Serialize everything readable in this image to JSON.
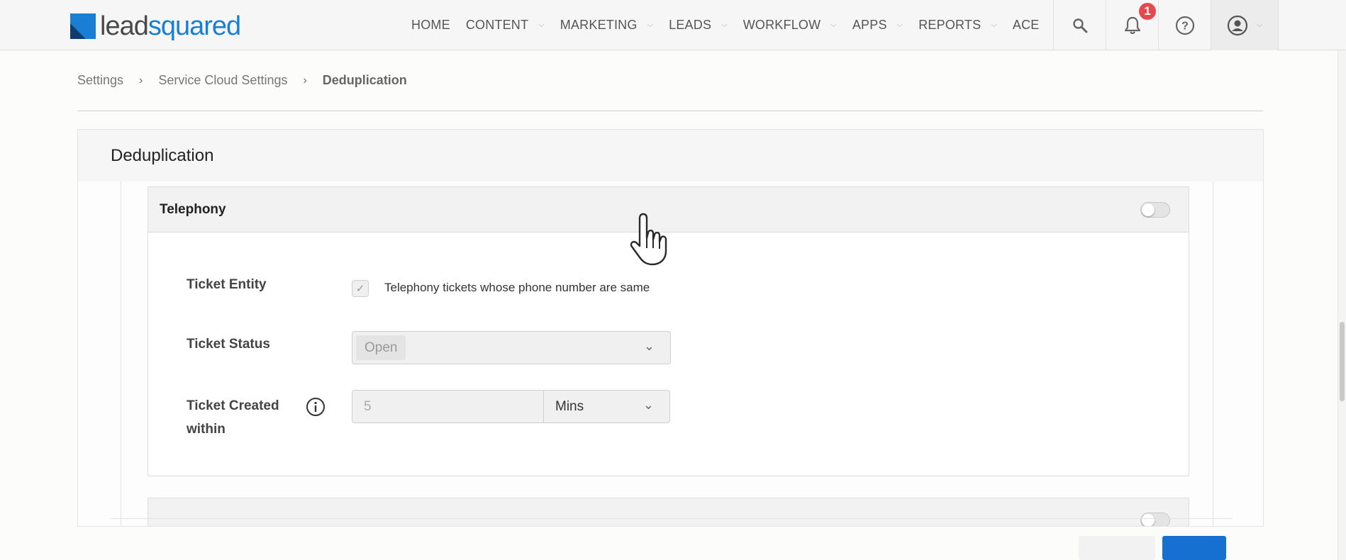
{
  "brand": {
    "part1": "lead",
    "part2": "squared"
  },
  "nav": {
    "items": [
      {
        "label": "HOME",
        "dropdown": false
      },
      {
        "label": "CONTENT",
        "dropdown": true
      },
      {
        "label": "MARKETING",
        "dropdown": true
      },
      {
        "label": "LEADS",
        "dropdown": true
      },
      {
        "label": "WORKFLOW",
        "dropdown": true
      },
      {
        "label": "APPS",
        "dropdown": true
      },
      {
        "label": "REPORTS",
        "dropdown": true
      },
      {
        "label": "ACE",
        "dropdown": false
      }
    ],
    "notification_count": "1",
    "icons": [
      "search-icon",
      "bell-icon",
      "help-icon",
      "user-icon"
    ]
  },
  "breadcrumb": {
    "items": [
      "Settings",
      "Service Cloud Settings",
      "Deduplication"
    ]
  },
  "panel": {
    "title": "Deduplication",
    "section": {
      "title": "Telephony",
      "toggle_on": false,
      "fields": {
        "ticket_entity_label": "Ticket Entity",
        "ticket_entity_checkbox_text": "Telephony tickets whose phone number are same",
        "ticket_status_label": "Ticket Status",
        "ticket_status_value": "Open",
        "ticket_created_label_line1": "Ticket Created",
        "ticket_created_label_line2": "within",
        "ticket_created_value": "5",
        "ticket_created_unit": "Mins"
      }
    }
  },
  "colors": {
    "accent": "#1a7fd4",
    "badge": "#e5484d",
    "primary_button": "#1570d1"
  }
}
